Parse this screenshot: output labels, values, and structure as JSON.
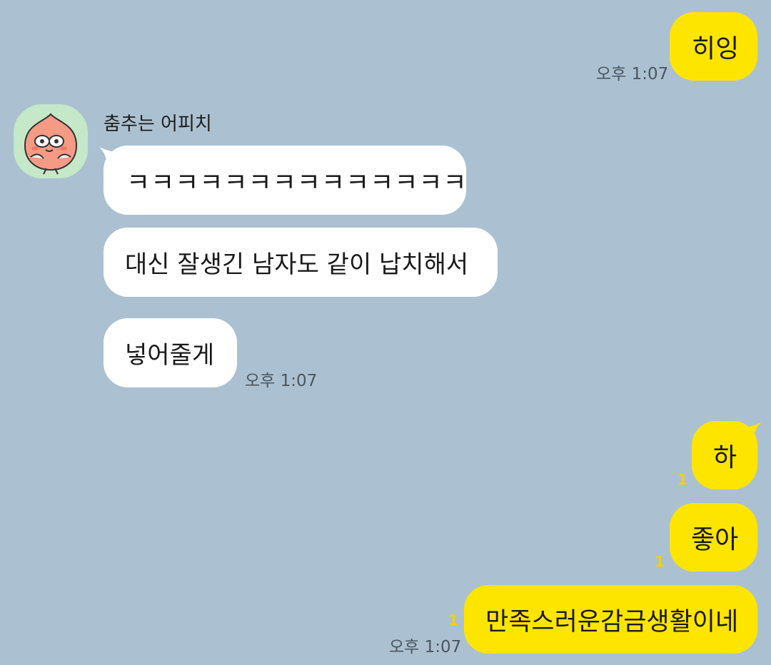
{
  "chat": {
    "messages": [
      {
        "id": "m1",
        "side": "mine",
        "text": "히잉",
        "time": "오후 1:07"
      },
      {
        "id": "m2",
        "side": "theirs",
        "sender": "춤추는 어피치",
        "text": "ㅋㅋㅋㅋㅋㅋㅋㅋㅋㅋㅋㅋㅋㅋ"
      },
      {
        "id": "m3",
        "side": "theirs",
        "text": "대신 잘생긴 남자도 같이 납치해서"
      },
      {
        "id": "m4",
        "side": "theirs",
        "text": "넣어줄게",
        "time": "오후 1:07"
      },
      {
        "id": "m5",
        "side": "mine",
        "text": "하",
        "unread": "1"
      },
      {
        "id": "m6",
        "side": "mine",
        "text": "좋아",
        "unread": "1"
      },
      {
        "id": "m7",
        "side": "mine",
        "text": "만족스러운감금생활이네",
        "unread": "1",
        "time": "오후 1:07"
      }
    ]
  },
  "colors": {
    "background": "#abc1d1",
    "my_bubble": "#fee500",
    "their_bubble": "#ffffff",
    "unread": "#f2d100",
    "timestamp": "#4a5660"
  },
  "icons": {
    "avatar": "apeach-peach-character"
  }
}
